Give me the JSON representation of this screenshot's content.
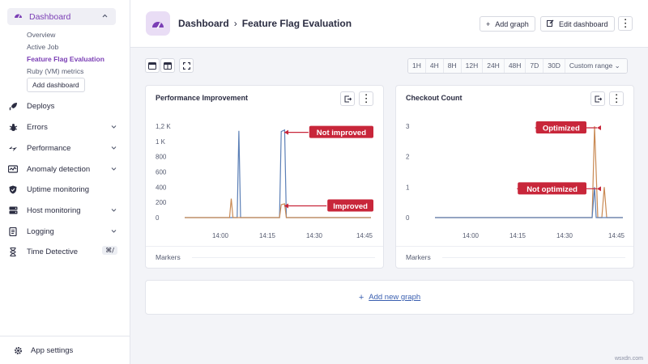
{
  "sidebar": {
    "dashboard_label": "Dashboard",
    "subitems": [
      "Overview",
      "Active Job",
      "Feature Flag Evaluation",
      "Ruby (VM) metrics"
    ],
    "add_dashboard_label": "Add dashboard",
    "items": [
      {
        "label": "Deploys",
        "icon": "rocket-icon"
      },
      {
        "label": "Errors",
        "icon": "bug-icon"
      },
      {
        "label": "Performance",
        "icon": "speed-icon"
      },
      {
        "label": "Anomaly detection",
        "icon": "anomaly-icon"
      },
      {
        "label": "Uptime monitoring",
        "icon": "shield-icon"
      },
      {
        "label": "Host monitoring",
        "icon": "server-icon"
      },
      {
        "label": "Logging",
        "icon": "logs-icon"
      },
      {
        "label": "Time Detective",
        "icon": "clock-icon",
        "shortcut": "⌘/"
      }
    ],
    "settings_label": "App settings"
  },
  "header": {
    "crumb_root": "Dashboard",
    "crumb_sep": "›",
    "crumb_current": "Feature Flag Evaluation",
    "add_graph": "Add graph",
    "edit_dashboard": "Edit dashboard",
    "more": "⋮"
  },
  "time_ranges": [
    "1H",
    "4H",
    "8H",
    "12H",
    "24H",
    "48H",
    "7D",
    "30D",
    "Custom range ⌄"
  ],
  "panels": {
    "left_title": "Performance Improvement",
    "right_title": "Checkout Count",
    "markers_label": "Markers"
  },
  "add_new_graph": "Add new graph",
  "watermark": "wsxdn.com",
  "colors": {
    "accent": "#7b3fb5",
    "series_blue": "#5b7fb6",
    "series_orange": "#c98a54",
    "annotation_red": "#c8263a"
  },
  "chart_data": [
    {
      "type": "line",
      "title": "Performance Improvement",
      "x_ticks": [
        "14:00",
        "14:15",
        "14:30",
        "14:45"
      ],
      "y_ticks": [
        "0",
        "200",
        "400",
        "600",
        "800",
        "1 K",
        "1,2 K"
      ],
      "ylim": [
        0,
        1200
      ],
      "series": [
        {
          "color": "#5b7fb6",
          "points": [
            [
              0,
              0
            ],
            [
              62,
              0
            ],
            [
              64,
              1140
            ],
            [
              66,
              0
            ],
            [
              112,
              0
            ],
            [
              114,
              1130
            ],
            [
              118,
              1150
            ],
            [
              120,
              0
            ],
            [
              220,
              0
            ]
          ]
        },
        {
          "color": "#c98a54",
          "points": [
            [
              0,
              0
            ],
            [
              53,
              0
            ],
            [
              55,
              250
            ],
            [
              57,
              0
            ],
            [
              112,
              0
            ],
            [
              114,
              170
            ],
            [
              118,
              180
            ],
            [
              120,
              0
            ],
            [
              220,
              0
            ]
          ]
        }
      ],
      "annotations": [
        {
          "text": "Not improved",
          "y": 1140
        },
        {
          "text": "Improved",
          "y": 175
        }
      ]
    },
    {
      "type": "line",
      "title": "Checkout Count",
      "x_ticks": [
        "14:00",
        "14:15",
        "14:30",
        "14:45"
      ],
      "y_ticks": [
        "0",
        "1",
        "2",
        "3"
      ],
      "ylim": [
        0,
        3
      ],
      "series": [
        {
          "color": "#c98a54",
          "points": [
            [
              0,
              0
            ],
            [
              194,
              0
            ],
            [
              197,
              3
            ],
            [
              201,
              0
            ],
            [
              206,
              0
            ],
            [
              209,
              1
            ],
            [
              212,
              0
            ],
            [
              232,
              0
            ]
          ]
        },
        {
          "color": "#5b7fb6",
          "points": [
            [
              0,
              0
            ],
            [
              194,
              0
            ],
            [
              197,
              1
            ],
            [
              199,
              0
            ],
            [
              232,
              0
            ]
          ]
        }
      ],
      "annotations": [
        {
          "text": "Optimized",
          "y": 3
        },
        {
          "text": "Not optimized",
          "y": 1
        }
      ]
    }
  ]
}
